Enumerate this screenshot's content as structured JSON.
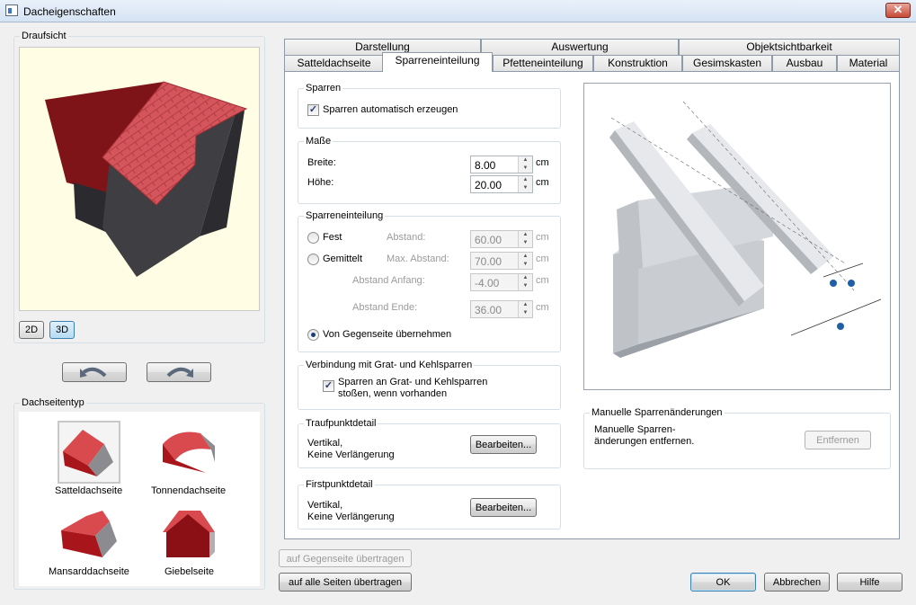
{
  "window": {
    "title": "Dacheigenschaften",
    "close_label": "✕"
  },
  "left": {
    "view_title": "Draufsicht",
    "btn_2d": "2D",
    "btn_3d": "3D",
    "types_title": "Dachseitentyp",
    "types": [
      {
        "label": "Satteldachseite",
        "selected": true
      },
      {
        "label": "Tonnendachseite",
        "selected": false
      },
      {
        "label": "Mansarddachseite",
        "selected": false
      },
      {
        "label": "Giebelseite",
        "selected": false
      }
    ]
  },
  "tabs_row1": [
    "Darstellung",
    "Auswertung",
    "Objektsichtbarkeit"
  ],
  "tabs_row2": [
    "Satteldachseite",
    "Sparreneinteilung",
    "Pfetteneinteilung",
    "Konstruktion",
    "Gesimskasten",
    "Ausbau",
    "Material"
  ],
  "active_tab": "Sparreneinteilung",
  "sparren": {
    "title": "Sparren",
    "auto_label": "Sparren automatisch erzeugen",
    "auto_checked": true
  },
  "masse": {
    "title": "Maße",
    "breite_label": "Breite:",
    "breite_value": "8.00",
    "hoehe_label": "Höhe:",
    "hoehe_value": "20.00",
    "unit": "cm"
  },
  "einteilung": {
    "title": "Sparreneinteilung",
    "fest_label": "Fest",
    "gemittelt_label": "Gemittelt",
    "abstand_label": "Abstand:",
    "abstand_value": "60.00",
    "max_abstand_label": "Max. Abstand:",
    "max_abstand_value": "70.00",
    "abstand_anfang_label": "Abstand Anfang:",
    "abstand_anfang_value": "-4.00",
    "abstand_ende_label": "Abstand Ende:",
    "abstand_ende_value": "36.00",
    "gegenseite_label": "Von Gegenseite übernehmen",
    "selected": "gegenseite",
    "unit": "cm"
  },
  "verbindung": {
    "title": "Verbindung mit Grat- und Kehlsparren",
    "check_line1": "Sparren an Grat- und Kehlsparren",
    "check_line2": "stoßen, wenn vorhanden",
    "checked": true
  },
  "traufpunkt": {
    "title": "Traufpunktdetail",
    "line1": "Vertikal,",
    "line2": "Keine Verlängerung",
    "edit_label": "Bearbeiten..."
  },
  "firstpunkt": {
    "title": "Firstpunktdetail",
    "line1": "Vertikal,",
    "line2": "Keine Verlängerung",
    "edit_label": "Bearbeiten..."
  },
  "manuell": {
    "title": "Manuelle Sparrenänderungen",
    "text_line1": "Manuelle Sparren-",
    "text_line2": "änderungen entfernen.",
    "remove_label": "Entfernen"
  },
  "bottom": {
    "gegenseite_btn": "auf Gegenseite übertragen",
    "alle_btn": "auf alle Seiten übertragen",
    "ok": "OK",
    "cancel": "Abbrechen",
    "help": "Hilfe"
  },
  "colors": {
    "roof_red": "#c8414a",
    "dark_red": "#7b1416",
    "wall": "#3f3f44",
    "preview_bg": "#fffde3",
    "accent_blue": "#3c7fb1"
  }
}
